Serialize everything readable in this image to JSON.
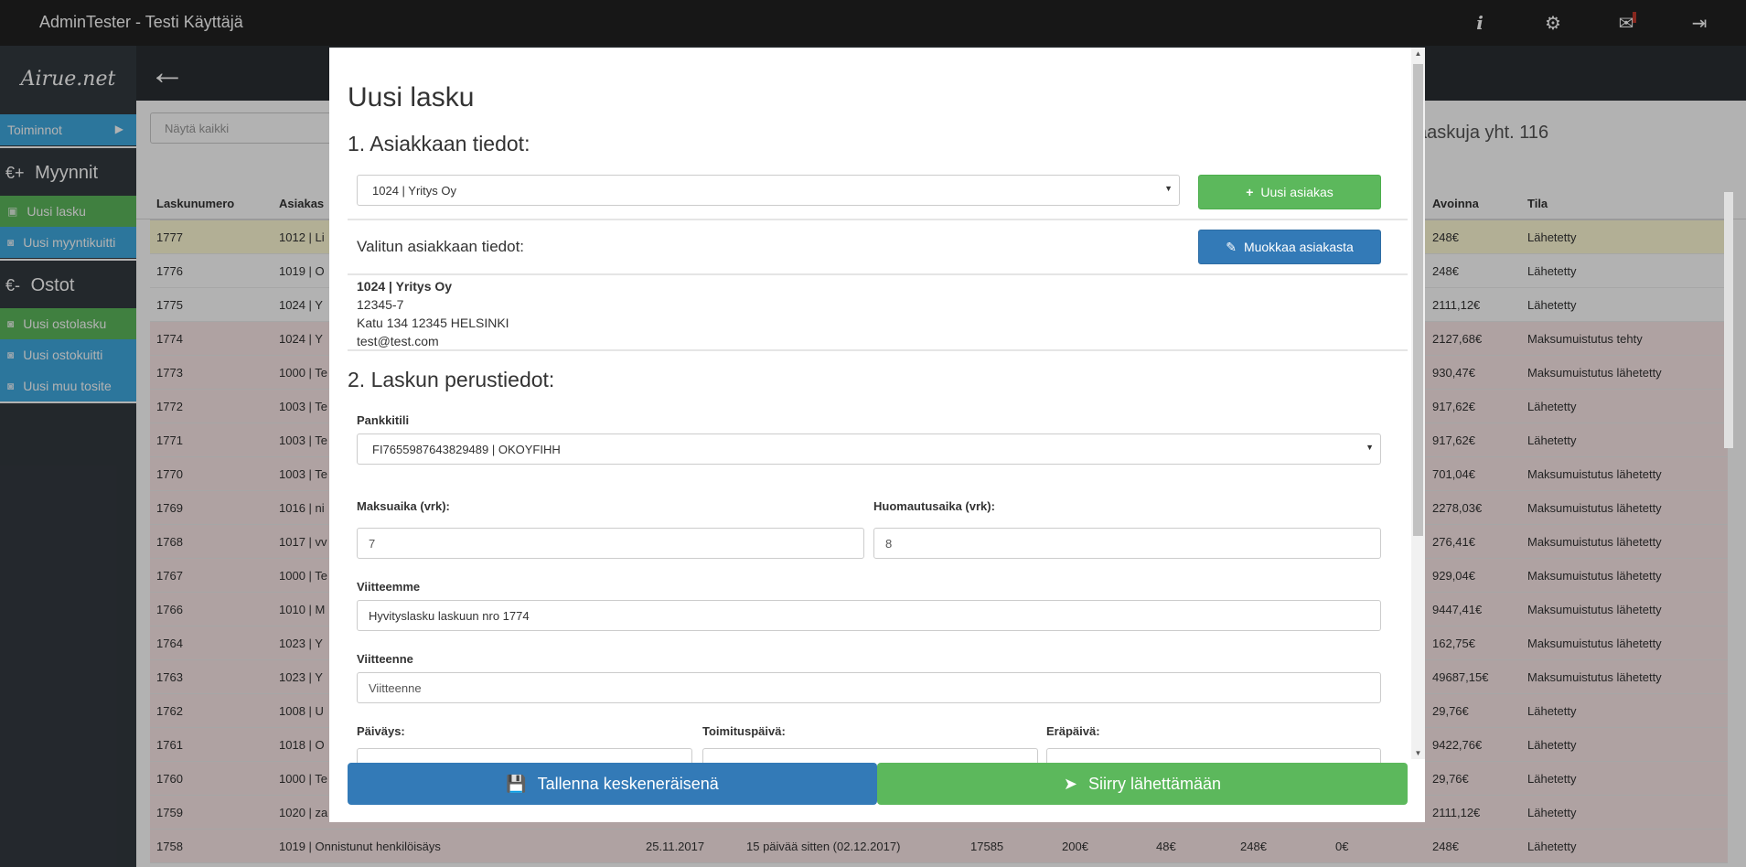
{
  "app": {
    "title": "AdminTester - Testi Käyttäjä",
    "logo": "Airue.net",
    "icons": [
      "info-icon",
      "gear-icon",
      "mail-icon",
      "logout-icon"
    ]
  },
  "sidebar": {
    "toiminnot": "Toiminnot",
    "myynnit": {
      "symbol": "€+",
      "label": "Myynnit"
    },
    "myynnit_items": [
      "Uusi lasku",
      "Uusi myyntikuitti"
    ],
    "ostot": {
      "symbol": "€-",
      "label": "Ostot"
    },
    "ostot_items": [
      "Uusi ostolasku",
      "Uusi ostokuitti",
      "Uusi muu tosite"
    ]
  },
  "main": {
    "filter_placeholder": "Näytä kaikki",
    "count_text": "aaskuja yht. 116",
    "columns": [
      "Laskunumero",
      "Asiakas",
      "",
      "",
      "",
      "",
      "",
      "",
      "",
      "Avoinna",
      "Tila"
    ],
    "rows": [
      {
        "num": "1777",
        "cust": "1012 | Li",
        "open": "248€",
        "state": "Lähetetty",
        "style": "hl"
      },
      {
        "num": "1776",
        "cust": "1019 | O",
        "open": "248€",
        "state": "Lähetetty",
        "style": ""
      },
      {
        "num": "1775",
        "cust": "1024 | Y",
        "open": "2111,12€",
        "state": "Lähetetty",
        "style": ""
      },
      {
        "num": "1774",
        "cust": "1024 | Y",
        "open": "2127,68€",
        "state": "Maksumuistutus tehty",
        "style": "red"
      },
      {
        "num": "1773",
        "cust": "1000 | Te",
        "open": "930,47€",
        "state": "Maksumuistutus lähetetty",
        "style": "red"
      },
      {
        "num": "1772",
        "cust": "1003 | Te",
        "open": "917,62€",
        "state": "Lähetetty",
        "style": "red"
      },
      {
        "num": "1771",
        "cust": "1003 | Te",
        "open": "917,62€",
        "state": "Lähetetty",
        "style": "red"
      },
      {
        "num": "1770",
        "cust": "1003 | Te",
        "open": "701,04€",
        "state": "Maksumuistutus lähetetty",
        "style": "red"
      },
      {
        "num": "1769",
        "cust": "1016 | ni",
        "open": "2278,03€",
        "state": "Maksumuistutus lähetetty",
        "style": "red"
      },
      {
        "num": "1768",
        "cust": "1017 | vv",
        "open": "276,41€",
        "state": "Maksumuistutus lähetetty",
        "style": "red"
      },
      {
        "num": "1767",
        "cust": "1000 | Te",
        "open": "929,04€",
        "state": "Maksumuistutus lähetetty",
        "style": "red"
      },
      {
        "num": "1766",
        "cust": "1010 | M",
        "open": "9447,41€",
        "state": "Maksumuistutus lähetetty",
        "style": "red"
      },
      {
        "num": "1764",
        "cust": "1023 | Y",
        "open": "162,75€",
        "state": "Maksumuistutus lähetetty",
        "style": "red"
      },
      {
        "num": "1763",
        "cust": "1023 | Y",
        "open": "49687,15€",
        "state": "Maksumuistutus lähetetty",
        "style": "red"
      },
      {
        "num": "1762",
        "cust": "1008 | U",
        "open": "29,76€",
        "state": "Lähetetty",
        "style": "red"
      },
      {
        "num": "1761",
        "cust": "1018 | O",
        "open": "9422,76€",
        "state": "Lähetetty",
        "style": "red"
      },
      {
        "num": "1760",
        "cust": "1000 | Te",
        "open": "29,76€",
        "state": "Lähetetty",
        "style": "red"
      },
      {
        "num": "1759",
        "cust": "1020 | za",
        "open": "2111,12€",
        "state": "Lähetetty",
        "style": "red"
      }
    ],
    "last_row": {
      "num": "1758",
      "cust": "1019 | Onnistunut henkilöisäys",
      "date": "25.11.2017",
      "rel": "15 päivää sitten (02.12.2017)",
      "a": "17585",
      "b": "200€",
      "c": "48€",
      "d": "248€",
      "e": "0€",
      "open": "248€",
      "state": "Lähetetty"
    }
  },
  "modal": {
    "title": "Uusi lasku",
    "section1": "1. Asiakkaan tiedot:",
    "customer_select": "1024 | Yritys Oy",
    "new_customer_btn": "Uusi asiakas",
    "selected_label": "Valitun asiakkaan tiedot:",
    "edit_customer_btn": "Muokkaa asiakasta",
    "customer": {
      "name": "1024 | Yritys Oy",
      "id": "12345-7",
      "address": "Katu 134 12345 HELSINKI",
      "email": "test@test.com"
    },
    "section2": "2. Laskun perustiedot:",
    "bank_label": "Pankkitili",
    "bank_value": "FI7655987643829489 | OKOYFIHH",
    "payment_label": "Maksuaika (vrk):",
    "payment_value": "7",
    "notice_label": "Huomautusaika (vrk):",
    "notice_value": "8",
    "our_ref_label": "Viitteemme",
    "our_ref_value": "Hyvityslasku laskuun nro 1774",
    "your_ref_label": "Viitteenne",
    "your_ref_placeholder": "Viitteenne",
    "date_label": "Päiväys:",
    "delivery_label": "Toimituspäivä:",
    "due_label": "Eräpäivä:",
    "save_draft_btn": "Tallenna keskeneräisenä",
    "send_btn": "Siirry lähettämään"
  },
  "colors": {
    "green": "#5cb85c",
    "blue": "#337ab7",
    "topbar": "#222222",
    "sidebar_blue": "#3fa9e0"
  }
}
